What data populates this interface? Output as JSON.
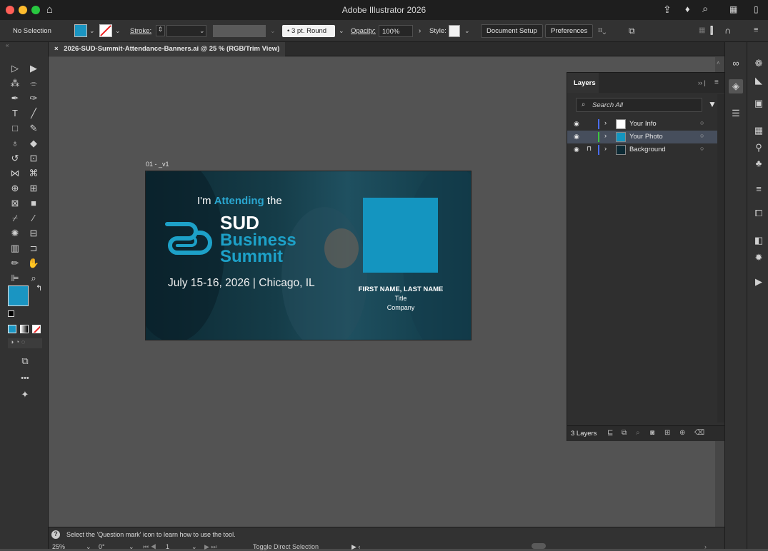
{
  "app": {
    "title": "Adobe Illustrator 2026"
  },
  "controlbar": {
    "selection": "No Selection",
    "stroke_label": "Stroke:",
    "brush": "3 pt. Round",
    "opacity_label": "Opacity:",
    "opacity_value": "100%",
    "style_label": "Style:",
    "document_setup": "Document Setup",
    "preferences": "Preferences"
  },
  "document": {
    "tab_title": "2026-SUD-Summit-Attendance-Banners.ai @ 25 % (RGB/Trim View)",
    "close_glyph": "×"
  },
  "artboard": {
    "label": "01 - _v1",
    "attending_prefix": "I'm ",
    "attending_word": "Attending",
    "attending_suffix": " the",
    "line1": "SUD",
    "line2": "Business",
    "line3": "Summit",
    "date": "July 15-16, 2026 | Chicago, IL",
    "name": "FIRST NAME, LAST NAME",
    "title": "Title",
    "company": "Company"
  },
  "layers": {
    "tab": "Layers",
    "search_placeholder": "Search All",
    "items": [
      {
        "name": "Your Info",
        "color": "#4a6cf0",
        "thumb": "#ffffff",
        "selected": false,
        "locked": false
      },
      {
        "name": "Your Photo",
        "color": "#3ec63e",
        "thumb": "#1495c0",
        "selected": true,
        "locked": false
      },
      {
        "name": "Background",
        "color": "#4a6cf0",
        "thumb": "#0d2a34",
        "selected": false,
        "locked": true
      }
    ],
    "count": "3 Layers"
  },
  "status": {
    "hint": "Select the 'Question mark' icon to learn how to use the tool.",
    "zoom": "25%",
    "rotation": "0°",
    "artboard_num": "1",
    "tool_name": "Toggle Direct Selection"
  },
  "colors": {
    "fill": "#1a95c2",
    "accent": "#1da1c8"
  }
}
